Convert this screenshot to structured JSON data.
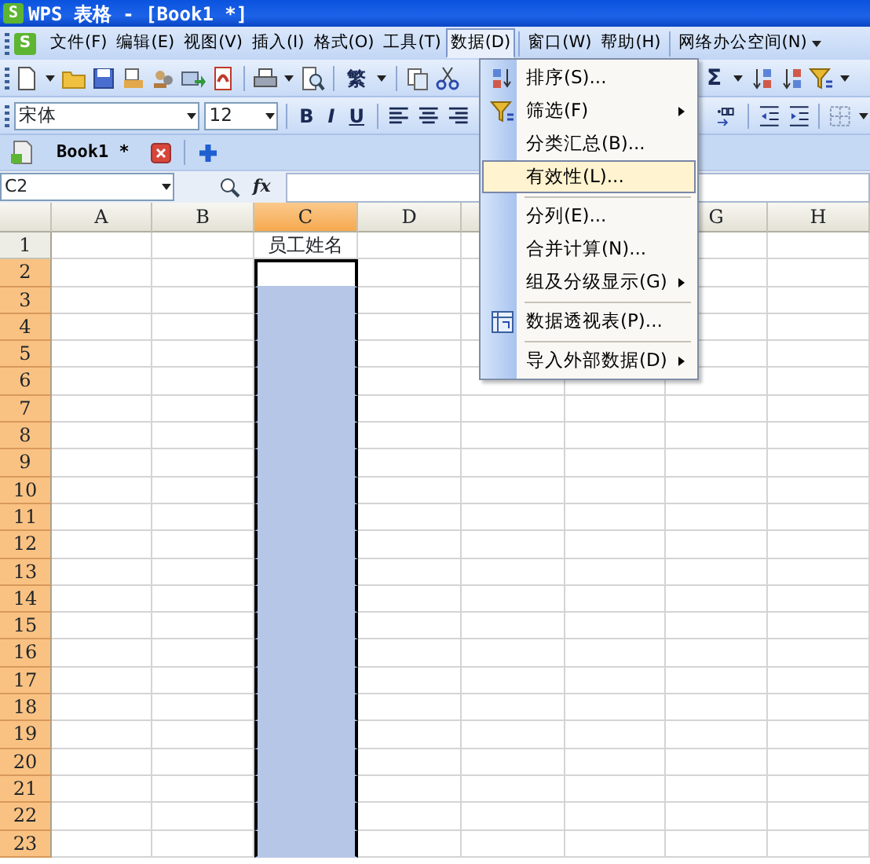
{
  "window": {
    "title": "WPS 表格 - [Book1 *]",
    "logo_letter": "S"
  },
  "menu_bar": {
    "logo_letter": "S",
    "items": [
      {
        "label": "文件(F)",
        "selected": false
      },
      {
        "label": "编辑(E)",
        "selected": false
      },
      {
        "label": "视图(V)",
        "selected": false
      },
      {
        "label": "插入(I)",
        "selected": false
      },
      {
        "label": "格式(O)",
        "selected": false
      },
      {
        "label": "工具(T)",
        "selected": false
      },
      {
        "label": "数据(D)",
        "selected": true
      },
      {
        "label": "窗口(W)",
        "selected": false
      },
      {
        "label": "帮助(H)",
        "selected": false
      },
      {
        "label": "网络办公空间(N)",
        "selected": false,
        "has_dropdown": true
      }
    ]
  },
  "standard_toolbar": {
    "traditional_chinese_button": "繁",
    "autosum_button": "Σ"
  },
  "formatting_toolbar": {
    "font": "宋体",
    "font_size": "12",
    "bold": "B",
    "italic": "I",
    "underline": "U"
  },
  "document_tabs": [
    {
      "label": "Book1 *",
      "selected": true
    }
  ],
  "formula_bar": {
    "name_box": "C2",
    "function_label": "fx"
  },
  "columns": [
    {
      "label": "A",
      "selected": false
    },
    {
      "label": "B",
      "selected": false
    },
    {
      "label": "C",
      "selected": true
    },
    {
      "label": "D",
      "selected": false
    },
    {
      "selected": false
    },
    {},
    {
      "label": "G",
      "selected": false
    },
    {
      "label": "H",
      "selected": false
    }
  ],
  "rows": [
    {
      "header": "1",
      "selected": false,
      "column_c": "员工姓名"
    },
    {
      "header": "2",
      "selected": true,
      "active": true
    },
    {
      "header": "3",
      "selected": true
    },
    {
      "header": "4",
      "selected": true
    },
    {
      "header": "5",
      "selected": true
    },
    {
      "header": "6",
      "selected": true
    },
    {
      "header": "7",
      "selected": true
    },
    {
      "header": "8",
      "selected": true
    },
    {
      "header": "9",
      "selected": true
    },
    {
      "header": "10",
      "selected": true
    },
    {
      "header": "11",
      "selected": true
    },
    {
      "header": "12",
      "selected": true
    },
    {
      "header": "13",
      "selected": true
    },
    {
      "header": "14",
      "selected": true
    },
    {
      "header": "15",
      "selected": true
    },
    {
      "header": "16",
      "selected": true
    },
    {
      "header": "17",
      "selected": true
    },
    {
      "header": "18",
      "selected": true
    },
    {
      "header": "19",
      "selected": true
    },
    {
      "header": "20",
      "selected": true
    },
    {
      "header": "21",
      "selected": true
    },
    {
      "header": "22",
      "selected": true
    },
    {
      "header": "23",
      "selected": true
    }
  ],
  "data_menu": {
    "items": [
      {
        "label": "排序(S)...",
        "kind": "sort",
        "selected": false,
        "has_submenu": false,
        "separator_before": false
      },
      {
        "label": "筛选(F)",
        "kind": "filter",
        "selected": false,
        "has_submenu": true,
        "separator_before": false
      },
      {
        "label": "分类汇总(B)...",
        "kind": "plain",
        "selected": false,
        "has_submenu": false,
        "separator_before": false
      },
      {
        "label": "有效性(L)...",
        "kind": "plain",
        "selected": true,
        "has_submenu": false,
        "separator_before": false
      },
      {
        "label": "分列(E)...",
        "kind": "plain",
        "selected": false,
        "has_submenu": false,
        "separator_before": true
      },
      {
        "label": "合并计算(N)...",
        "kind": "plain",
        "selected": false,
        "has_submenu": false,
        "separator_before": false
      },
      {
        "label": "组及分级显示(G)",
        "kind": "plain",
        "selected": false,
        "has_submenu": true,
        "separator_before": false
      },
      {
        "label": "数据透视表(P)...",
        "kind": "pivot",
        "selected": false,
        "has_submenu": false,
        "separator_before": true
      },
      {
        "label": "导入外部数据(D)",
        "kind": "plain",
        "selected": false,
        "has_submenu": true,
        "separator_before": true
      }
    ]
  }
}
